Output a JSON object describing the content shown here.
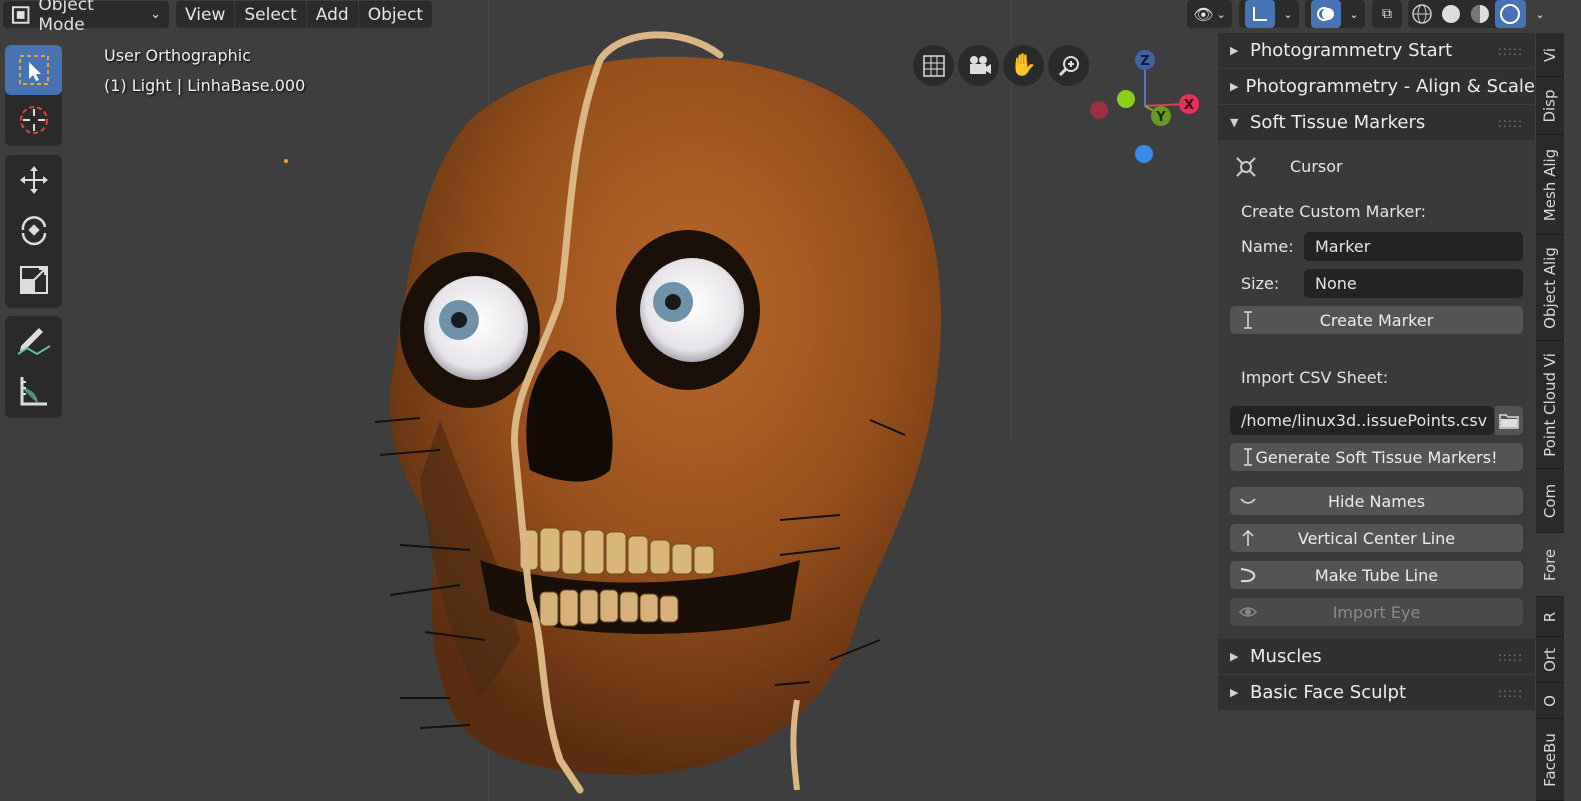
{
  "header": {
    "mode": "Object Mode",
    "menus": [
      "View",
      "Select",
      "Add",
      "Object"
    ]
  },
  "viewport": {
    "view_name": "User Orthographic",
    "object_info": "(1) Light | LinhaBase.000"
  },
  "gizmo": {
    "z": "Z",
    "y": "Y",
    "x": "X"
  },
  "sidebar": {
    "panels": {
      "photogrammetry_start": "Photogrammetry Start",
      "photogrammetry_align": "Photogrammetry - Align & Scale",
      "soft_tissue": "Soft Tissue Markers",
      "muscles": "Muscles",
      "basic_face_sculpt": "Basic Face Sculpt"
    },
    "soft_tissue": {
      "cursor_label": "Cursor",
      "create_custom_marker": "Create Custom Marker:",
      "name_label": "Name:",
      "name_value": "Marker",
      "size_label": "Size:",
      "size_value": "None",
      "create_marker": "Create Marker",
      "import_csv": "Import CSV Sheet:",
      "csv_path": "/home/linux3d..issuePoints.csv",
      "generate": "Generate Soft Tissue Markers!",
      "hide_names": "Hide Names",
      "vertical_center": "Vertical Center Line",
      "make_tube": "Make Tube Line",
      "import_eye": "Import Eye"
    }
  },
  "tabs": [
    "Vi",
    "Disp",
    "Mesh Alig",
    "Object Alig",
    "Point Cloud Vi",
    "Com",
    "Fore",
    "R",
    "Ort",
    "O",
    "FaceBu"
  ]
}
